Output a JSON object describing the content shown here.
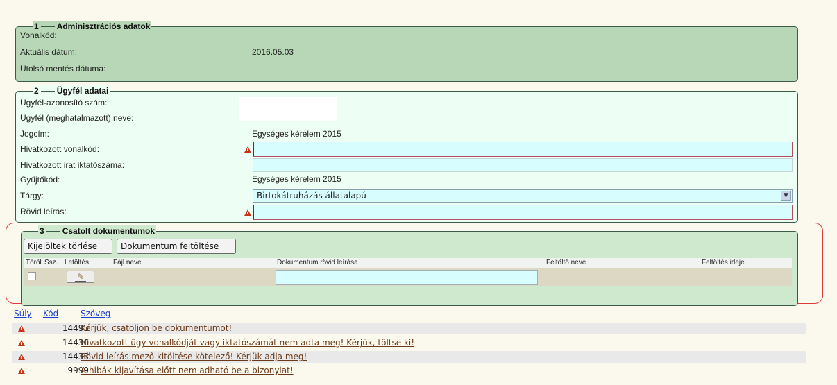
{
  "colors": {
    "page_bg": "#fbf8ed",
    "section1_bg": "#b7d7b7",
    "section2_bg": "#edfff5",
    "section3_bg": "#cfe9cf",
    "input_bg": "#d8fdff",
    "error_border": "#b35060",
    "warning_icon": "#c73518",
    "link_blue": "#1a3fc9",
    "message_link": "#6b3a1a",
    "outline_red": "#d93a3a"
  },
  "section1": {
    "number": "1",
    "title": "Adminisztrációs adatok",
    "fields": [
      {
        "label": "Vonalkód:",
        "value": ""
      },
      {
        "label": "Aktuális dátum:",
        "value": "2016.05.03"
      },
      {
        "label": "Utolsó mentés dátuma:",
        "value": ""
      }
    ]
  },
  "section2": {
    "number": "2",
    "title": "Ügyfél adatai",
    "client_id_label": "Ügyfél-azonosító szám:",
    "client_name_label": "Ügyfél (meghatalmazott) neve:",
    "jogcim_label": "Jogcím:",
    "jogcim_value": "Egységes kérelem 2015",
    "ref_barcode_label": "Hivatkozott vonalkód:",
    "ref_barcode_value": "",
    "ref_filing_label": "Hivatkozott irat iktatószáma:",
    "ref_filing_value": "",
    "collection_label": "Gyűjtőkód:",
    "collection_value": "Egységes kérelem 2015",
    "subject_label": "Tárgy:",
    "subject_value": "Birtokátruházás állatalapú",
    "short_desc_label": "Rövid leírás:",
    "short_desc_value": ""
  },
  "section3": {
    "number": "3",
    "title": "Csatolt dokumentumok",
    "delete_button": "Kijelöltek törlése",
    "upload_button": "Dokumentum feltöltése",
    "columns": [
      "Töröl",
      "Ssz.",
      "Letöltés",
      "Fájl neve",
      "Dokumentum rövid leírása",
      "Feltöltő neve",
      "Feltöltés ideje"
    ],
    "row": {
      "file_name": "",
      "description": "",
      "uploader": "",
      "uploaded_at": ""
    }
  },
  "messages": {
    "headers": {
      "weight": "Súly",
      "code": "Kód",
      "text": "Szöveg"
    },
    "items": [
      {
        "icon": "warning-icon",
        "code": "14495",
        "text": "Kérjük, csatoljon be dokumentumot!"
      },
      {
        "icon": "warning-icon",
        "code": "14430",
        "text": "Hivatkozott ügy vonalkódját vagy iktatószámát nem adta meg! Kérjük, töltse ki!"
      },
      {
        "icon": "warning-icon",
        "code": "14433",
        "text": "Rövid leírás mező kitöltése kötelező! Kérjük adja meg!"
      },
      {
        "icon": "warning-icon",
        "code": "9999",
        "text": "A hibák kijavítása előtt nem adható be a bizonylat!"
      }
    ]
  }
}
